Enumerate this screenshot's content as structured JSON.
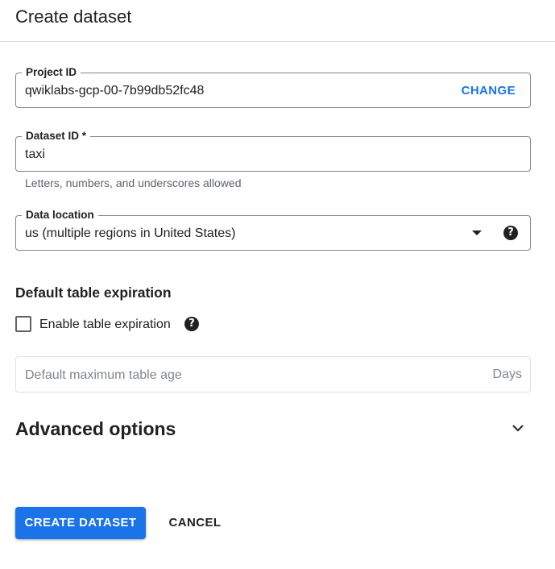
{
  "header": {
    "title": "Create dataset"
  },
  "project_id": {
    "label": "Project ID",
    "value": "qwiklabs-gcp-00-7b99db52fc48",
    "change_label": "CHANGE"
  },
  "dataset_id": {
    "label": "Dataset ID *",
    "value": "taxi",
    "hint": "Letters, numbers, and underscores allowed"
  },
  "data_location": {
    "label": "Data location",
    "selected": "us (multiple regions in United States)",
    "help_icon": "help-circle-icon",
    "arrow_icon": "dropdown-arrow-icon"
  },
  "table_expiration": {
    "section_title": "Default table expiration",
    "checkbox_label": "Enable table expiration",
    "checked": false,
    "help_icon": "help-circle-icon",
    "max_age_placeholder": "Default maximum table age",
    "max_age_suffix": "Days"
  },
  "advanced": {
    "title": "Advanced options",
    "expand_icon": "chevron-down-icon"
  },
  "actions": {
    "create_label": "CREATE DATASET",
    "cancel_label": "CANCEL"
  },
  "colors": {
    "accent": "#1a73e8",
    "text": "#202124",
    "muted": "#5f6368",
    "border": "#80868b"
  }
}
